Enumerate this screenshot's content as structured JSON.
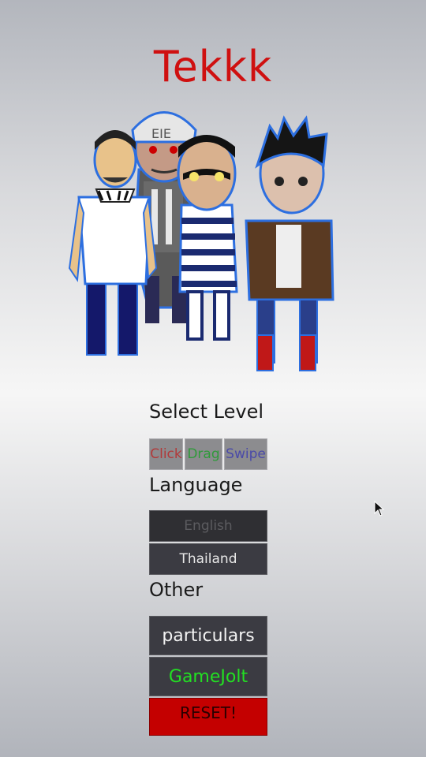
{
  "title": "Tekkk",
  "select_level": {
    "label": "Select Level",
    "options": [
      {
        "label": "Click",
        "color": "#b13a3a"
      },
      {
        "label": "Drag",
        "color": "#2f9a3a"
      },
      {
        "label": "Swipe",
        "color": "#4a4aa8"
      }
    ]
  },
  "language": {
    "label": "Language",
    "options": [
      {
        "label": "English",
        "state": "disabled"
      },
      {
        "label": "Thailand",
        "state": "enabled"
      }
    ]
  },
  "other": {
    "label": "Other",
    "buttons": {
      "particulars": "particulars",
      "gamejolt": "GameJolt",
      "reset": "RESET!"
    }
  },
  "colors": {
    "title": "#cf1010",
    "gamejolt": "#22e022",
    "reset_bg": "#c40000",
    "button_dark": "#3a3a40"
  },
  "icons": [
    "mouse-cursor-icon"
  ]
}
